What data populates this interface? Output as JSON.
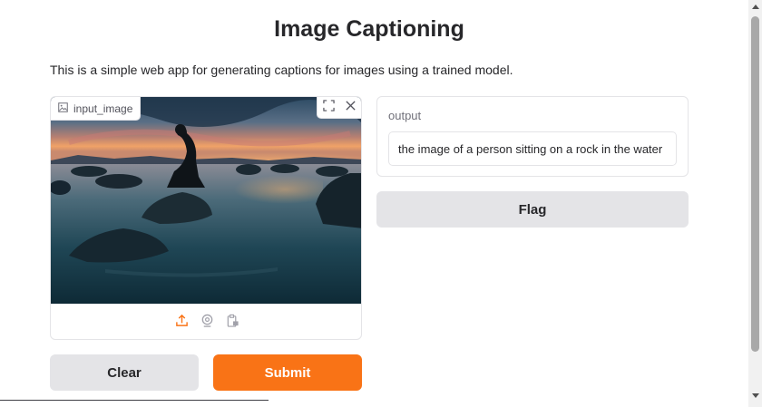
{
  "header": {
    "title": "Image Captioning",
    "description": "This is a simple web app for generating captions for images using a trained model."
  },
  "input_image": {
    "label": "input_image",
    "label_icon": "image-icon",
    "tools": [
      "fullscreen-icon",
      "close-icon"
    ],
    "photo_description_icon": "photo",
    "sources": [
      "upload-icon",
      "webcam-icon",
      "clipboard-icon"
    ]
  },
  "output": {
    "label": "output",
    "value": "the image of a person sitting on a rock in the water"
  },
  "buttons": {
    "flag": "Flag",
    "clear": "Clear",
    "submit": "Submit"
  },
  "colors": {
    "accent": "#f97316",
    "secondary_button": "#e4e4e7"
  }
}
